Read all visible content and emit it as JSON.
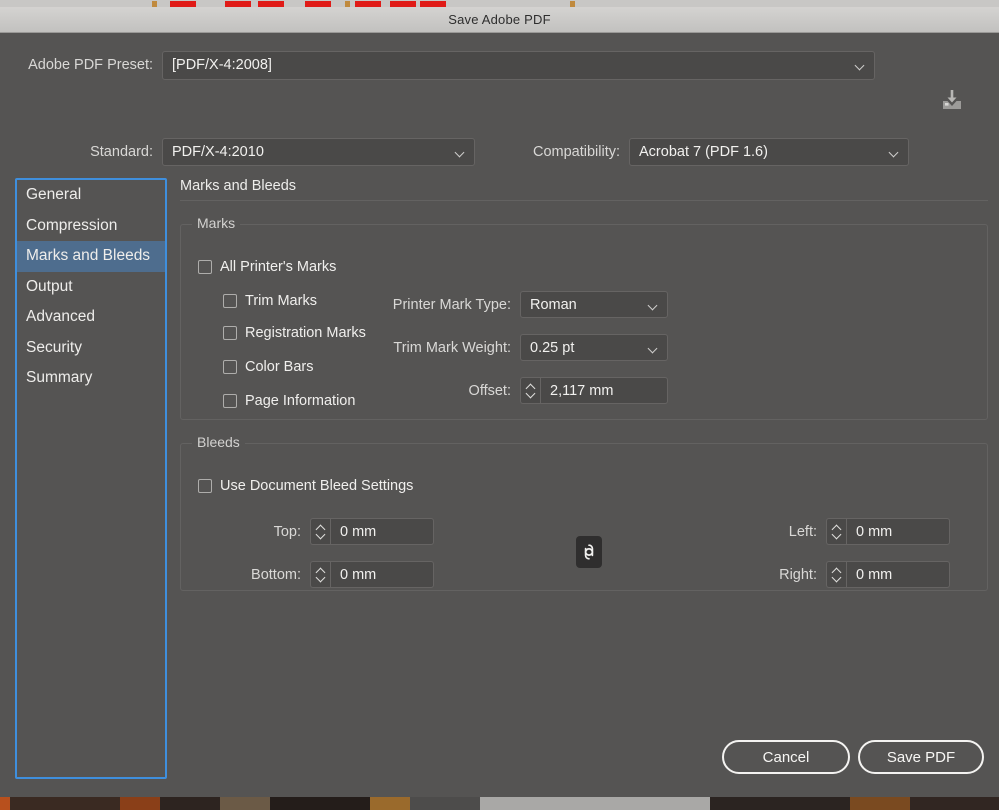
{
  "window": {
    "title": "Save Adobe PDF"
  },
  "preset": {
    "label": "Adobe PDF Preset:",
    "value": "[PDF/X-4:2008]",
    "export_icon": "save-preset-icon"
  },
  "standard": {
    "label": "Standard:",
    "value": "PDF/X-4:2010"
  },
  "compatibility": {
    "label": "Compatibility:",
    "value": "Acrobat 7 (PDF 1.6)"
  },
  "sidebar": {
    "items": [
      {
        "label": "General",
        "selected": false
      },
      {
        "label": "Compression",
        "selected": false
      },
      {
        "label": "Marks and Bleeds",
        "selected": true
      },
      {
        "label": "Output",
        "selected": false
      },
      {
        "label": "Advanced",
        "selected": false
      },
      {
        "label": "Security",
        "selected": false
      },
      {
        "label": "Summary",
        "selected": false
      }
    ]
  },
  "panel": {
    "heading": "Marks and Bleeds",
    "marks": {
      "title": "Marks",
      "all_printers_marks": {
        "label": "All Printer's Marks",
        "checked": false
      },
      "checkboxes": [
        {
          "label": "Trim Marks",
          "checked": false
        },
        {
          "label": "Registration Marks",
          "checked": false
        },
        {
          "label": "Color Bars",
          "checked": false
        },
        {
          "label": "Page Information",
          "checked": false
        }
      ],
      "printer_mark_type": {
        "label": "Printer Mark Type:",
        "value": "Roman"
      },
      "trim_mark_weight": {
        "label": "Trim Mark Weight:",
        "value": "0.25 pt"
      },
      "offset": {
        "label": "Offset:",
        "value": "2,117 mm"
      }
    },
    "bleeds": {
      "title": "Bleeds",
      "use_document_bleed": {
        "label": "Use Document Bleed Settings",
        "checked": false
      },
      "top": {
        "label": "Top:",
        "value": "0 mm"
      },
      "bottom": {
        "label": "Bottom:",
        "value": "0 mm"
      },
      "left": {
        "label": "Left:",
        "value": "0 mm"
      },
      "right": {
        "label": "Right:",
        "value": "0 mm"
      },
      "link_icon": "chain-link-icon"
    }
  },
  "footer": {
    "cancel_label": "Cancel",
    "save_label": "Save PDF"
  },
  "colors": {
    "dialog_bg": "#555453",
    "titlebar": "#c9c8c6",
    "field_bg": "#4a4948",
    "selection_blue": "#4e6d8e",
    "focus_ring": "#3f8fdd",
    "text": "#f2f1ef"
  }
}
